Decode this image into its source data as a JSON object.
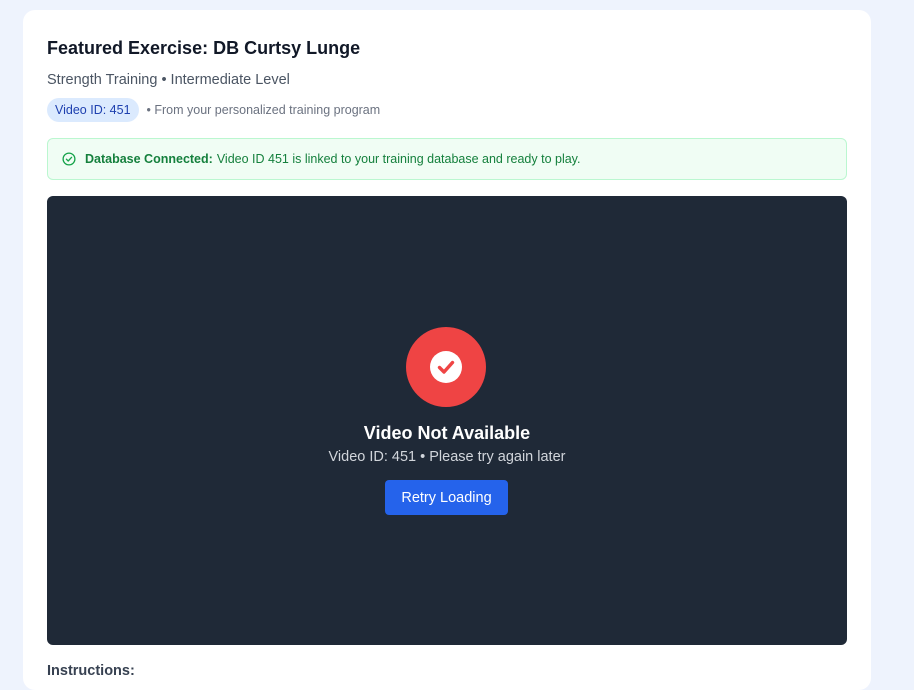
{
  "exercise": {
    "title": "Featured Exercise: DB Curtsy Lunge",
    "subtitle": "Strength Training • Intermediate Level",
    "video_badge": "Video ID: 451",
    "source_note": "• From your personalized training program"
  },
  "alert": {
    "icon": "check-circle-icon",
    "status_label": "Database Connected:",
    "message": "Video ID 451 is linked to your training database and ready to play.",
    "color": "#15803d"
  },
  "player": {
    "icon": "check-circle-icon",
    "error_title": "Video Not Available",
    "error_subtitle": "Video ID: 451 • Please try again later",
    "retry_label": "Retry Loading",
    "icon_color": "#ef4444",
    "background": "#1f2937",
    "button_color": "#2563eb"
  },
  "instructions": {
    "heading": "Instructions:"
  }
}
